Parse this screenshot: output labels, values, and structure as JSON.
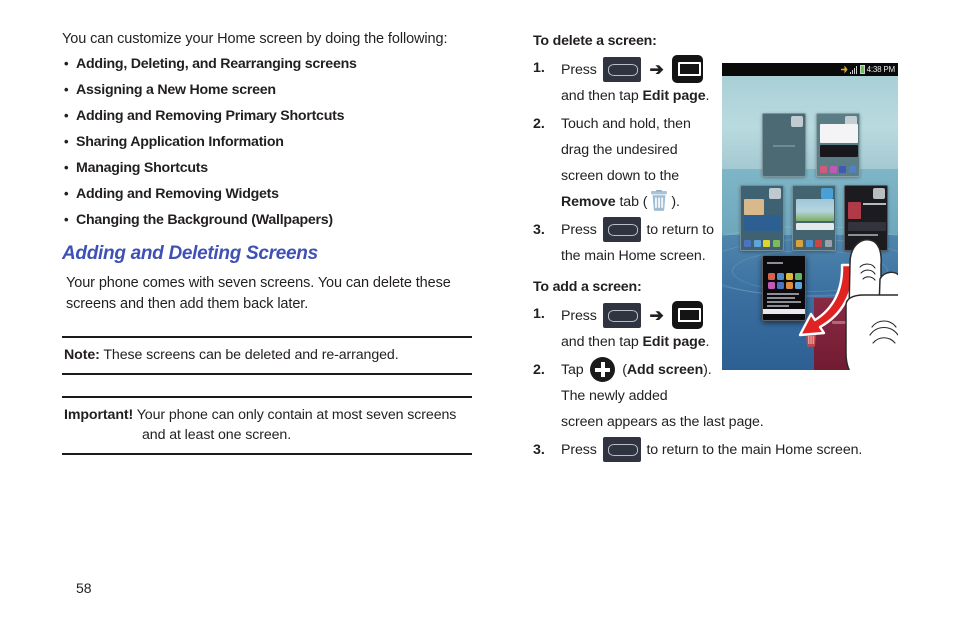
{
  "page": {
    "number": "58"
  },
  "left": {
    "intro": "You can customize your Home screen by doing the following:",
    "bullets": [
      {
        "dot": "•",
        "label": "Adding, Deleting, and Rearranging screens"
      },
      {
        "dot": "•",
        "label": "Assigning a New Home screen"
      },
      {
        "dot": "•",
        "label": "Adding and Removing Primary Shortcuts"
      },
      {
        "dot": "•",
        "label": "Sharing Application Information"
      },
      {
        "dot": "•",
        "label": "Managing Shortcuts"
      },
      {
        "dot": "•",
        "label": "Adding and Removing Widgets"
      },
      {
        "dot": "•",
        "label": "Changing the Background (Wallpapers)"
      }
    ],
    "section_heading": "Adding and Deleting Screens",
    "section_heading_color": "#4051b5",
    "paragraph": "Your phone comes with seven screens. You can delete these screens and then add them back later.",
    "note": {
      "label": "Note:",
      "text": "These screens can be deleted and re-arranged."
    },
    "important": {
      "label": "Important!",
      "text": "Your phone can only contain at most seven screens",
      "text_line2": "and at least one screen."
    }
  },
  "right": {
    "delete": {
      "heading": "To delete a screen:",
      "steps": [
        {
          "num": "1.",
          "pre": "Press",
          "mid": "",
          "post": "and then tap",
          "bold": "Edit page",
          "end": "."
        },
        {
          "num": "2.",
          "line1": "Touch and hold, then",
          "line2": "drag the undesired",
          "line3": "screen down to the",
          "bold": "Remove",
          "tab_word": "tab (",
          "close": ")."
        },
        {
          "num": "3.",
          "pre": "Press",
          "post": "to return to",
          "line2": "the main Home screen."
        }
      ]
    },
    "add": {
      "heading": "To add a screen:",
      "steps": [
        {
          "num": "1.",
          "pre": "Press",
          "post": "and then tap",
          "bold": "Edit page",
          "end": "."
        },
        {
          "num": "2.",
          "pre": "Tap",
          "open": "(",
          "bold": "Add screen",
          "close": ").",
          "line2": "The newly added",
          "line3": "screen appears as the last page."
        },
        {
          "num": "3.",
          "pre": "Press",
          "post": "to return to the main Home screen."
        }
      ]
    },
    "icons": {
      "home": "home-button-icon",
      "arrow": "➔",
      "menu": "menu-button-icon",
      "trash": "trash-icon",
      "plus": "add-screen-plus-icon"
    }
  },
  "phone_screenshot": {
    "status_bar": {
      "time": "4:38 PM",
      "icons": [
        "sync-icon",
        "signal-icon",
        "battery-icon"
      ]
    },
    "caption": "Home screen edit-page view with seven page thumbnails, a page being dragged to the Remove tab"
  }
}
